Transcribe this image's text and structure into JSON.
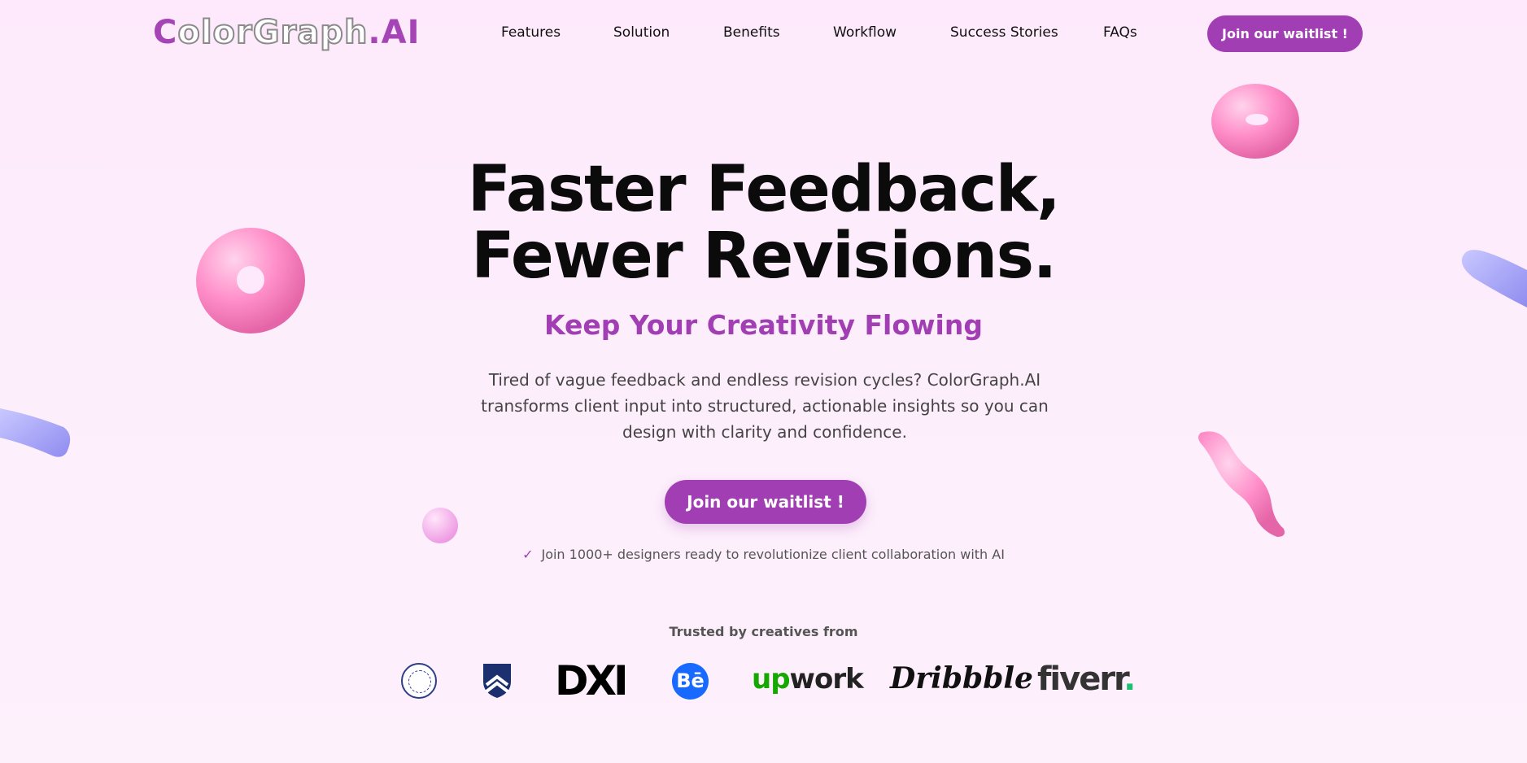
{
  "brand": {
    "logo_first": "C",
    "logo_mid": "olorGraph",
    "logo_suffix": ".AI"
  },
  "nav": {
    "items": [
      {
        "label": "Features"
      },
      {
        "label": "Solution"
      },
      {
        "label": "Benefits"
      },
      {
        "label": "Workflow"
      },
      {
        "label": "Success Stories"
      },
      {
        "label": "FAQs"
      }
    ],
    "cta_label": "Join our waitlist !"
  },
  "hero": {
    "title_line1": "Faster Feedback,",
    "title_line2": "Fewer Revisions.",
    "subtitle": "Keep Your Creativity Flowing",
    "description": "Tired of vague feedback and endless revision cycles? ColorGraph.AI transforms client input into structured, actionable insights so you can design with clarity and confidence.",
    "cta_label": "Join our waitlist !",
    "note_check": "✓",
    "note": "Join 1000+ designers ready to revolutionize client collaboration with AI"
  },
  "trusted": {
    "heading": "Trusted by creatives from",
    "logos": {
      "dxi": "DXI",
      "behance": "Bē",
      "upwork_up": "up",
      "upwork_rest": "work",
      "dribbble": "Dribbble",
      "fiverr": "fiverr",
      "fiverr_dot": "."
    }
  },
  "colors": {
    "accent": "#a23eb3",
    "background": "#fdecfb",
    "heading": "#0b0b0b"
  }
}
